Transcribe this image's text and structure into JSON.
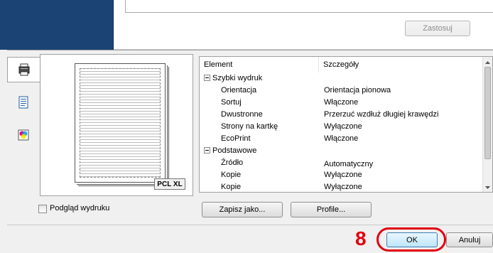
{
  "top": {
    "apply_label": "Zastosuj"
  },
  "tabs": [
    {
      "icon": "printer-icon",
      "active": true
    },
    {
      "icon": "document-icon",
      "active": false
    },
    {
      "icon": "color-icon",
      "active": false
    }
  ],
  "preview": {
    "badge": "PCL XL"
  },
  "details": {
    "columns": [
      "Element",
      "Szczegóły"
    ],
    "rows": [
      {
        "group": true,
        "label": "Szybki wydruk"
      },
      {
        "label": "Orientacja",
        "value": "Orientacja pionowa"
      },
      {
        "label": "Sortuj",
        "value": "Włączone"
      },
      {
        "label": "Dwustronne",
        "value": "Przerzuć wzdłuż długiej krawędzi"
      },
      {
        "label": "Strony na kartkę",
        "value": "Wyłączone"
      },
      {
        "label": "EcoPrint",
        "value": "Włączone"
      },
      {
        "group": true,
        "label": "Podstawowe"
      },
      {
        "label": "Źródło",
        "value": "Automatyczny"
      },
      {
        "label": "Kopie",
        "value": "Wyłączone"
      },
      {
        "label": "Kopie",
        "value": "Wyłączone"
      }
    ]
  },
  "actions": {
    "save_as": "Zapisz jako...",
    "profile": "Profile..."
  },
  "preview_option": {
    "label": "Podgląd wydruku",
    "checked": false
  },
  "footer": {
    "ok": "OK",
    "cancel": "Anuluj",
    "step": "8"
  },
  "colors": {
    "highlight": "#e1000f",
    "header_blue": "#1b4475"
  }
}
